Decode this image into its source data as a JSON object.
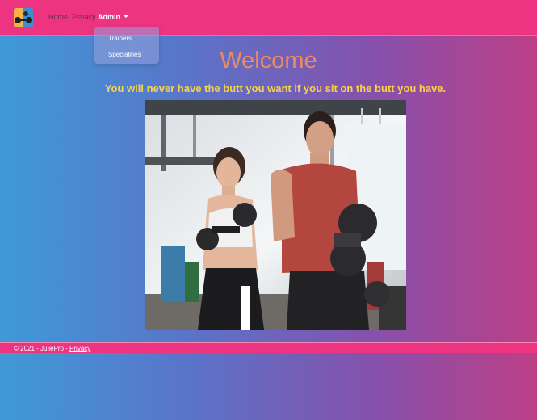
{
  "navbar": {
    "brand_icon": "gym-logo-icon",
    "links": {
      "home": "Home",
      "privacy": "Privacy",
      "admin": "Admin"
    },
    "admin_dropdown": {
      "items": [
        "Trainers",
        "Specialities"
      ]
    }
  },
  "main": {
    "title": "Welcome",
    "quote": "You will never have the butt you want if you sit on the butt you have."
  },
  "footer": {
    "prefix": "© 2021 - JuliePro - ",
    "privacy_link": "Privacy"
  },
  "colors": {
    "navbar": "#ec3480",
    "title": "#f08a5d",
    "quote": "#f8d24a",
    "gradient_start": "#3f9ad6",
    "gradient_end": "#bd3f86"
  }
}
